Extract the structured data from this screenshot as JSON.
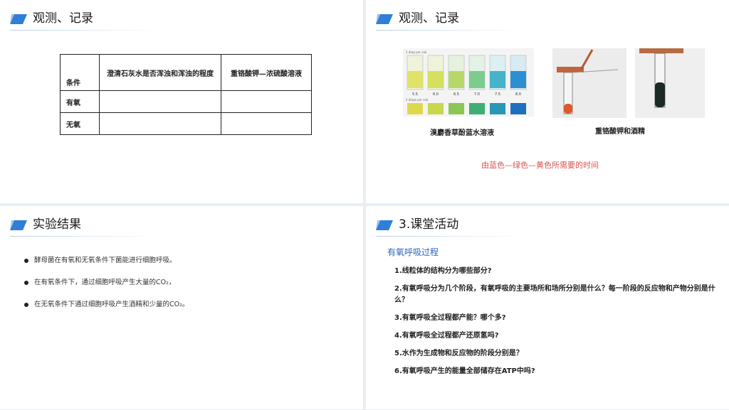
{
  "slides": [
    {
      "title": "观测、记录"
    },
    {
      "title": "观测、记录"
    },
    {
      "title": "实验结果"
    },
    {
      "title": "3.课堂活动"
    }
  ],
  "colors": {
    "accent": "#2f7fd6",
    "red_text": "#d9534f",
    "subtitle": "#2c66b8"
  },
  "table": {
    "col0_header": "条件",
    "col1_header": "澄清石灰水是否浑浊和浑浊的程度",
    "col2_header": "重铬酸钾—浓硫酸溶液",
    "rows": [
      "有氧",
      "无氧"
    ]
  },
  "images": {
    "left_caption": "溴麝香草酚蓝水溶液",
    "right_caption": "重铬酸钾和酒精",
    "strip1_label": "1 drop per vial",
    "strip2_label": "2 drops per vial",
    "ph_values": [
      "5.5",
      "6.0",
      "6.5",
      "7.0",
      "7.5",
      "8.0"
    ],
    "note": "由蓝色—绿色—黄色所需要的时间"
  },
  "results": [
    "酵母菌在有氧和无氧条件下菌能进行细胞呼吸。",
    "在有氧条件下，通过细胞呼吸产生大量的CO₂，",
    "在无氧条件下通过细胞呼吸产生酒精和少量的CO₂。"
  ],
  "activity": {
    "subtitle": "有氧呼吸过程",
    "questions": [
      "1.线粒体的结构分为哪些部分?",
      "2.有氧呼吸分为几个阶段，有氧呼吸的主要场所和场所分别是什么？每一阶段的反应物和产物分别是什么？",
      "3.有氧呼吸全过程都产能？哪个多?",
      "4.有氧呼吸全过程都产还原氢吗?",
      "5.水作为生成物和反应物的阶段分别是？",
      "6.有氧呼吸产生的能量全部储存在ATP中吗?"
    ]
  }
}
